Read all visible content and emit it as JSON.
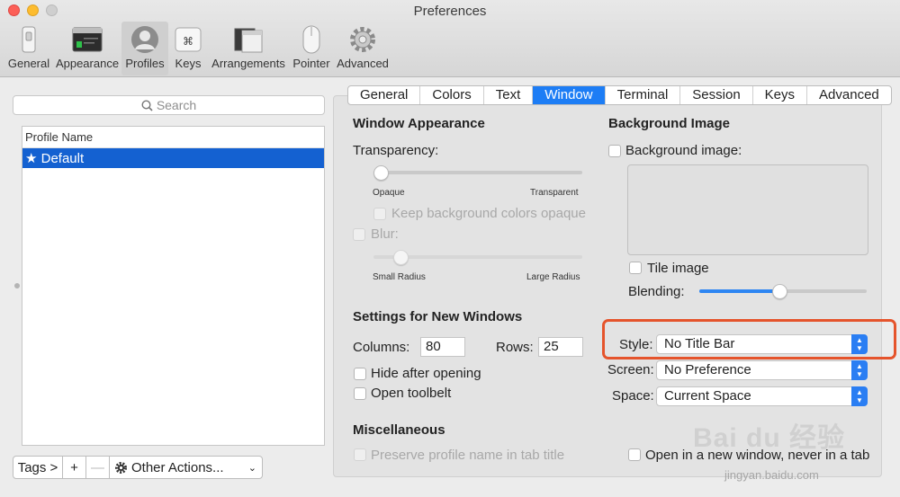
{
  "window": {
    "title": "Preferences"
  },
  "toolbar": {
    "items": [
      {
        "label": "General",
        "icon": "general-switch-icon"
      },
      {
        "label": "Appearance",
        "icon": "appearance-terminal-icon"
      },
      {
        "label": "Profiles",
        "icon": "profiles-person-icon",
        "selected": true
      },
      {
        "label": "Keys",
        "icon": "keys-command-icon"
      },
      {
        "label": "Arrangements",
        "icon": "arrangements-windows-icon"
      },
      {
        "label": "Pointer",
        "icon": "pointer-mouse-icon"
      },
      {
        "label": "Advanced",
        "icon": "advanced-gear-icon"
      }
    ]
  },
  "sidebar": {
    "search_placeholder": "Search",
    "column_header": "Profile Name",
    "profiles": [
      {
        "name": "★ Default",
        "selected": true
      }
    ],
    "buttons": {
      "tags": "Tags >",
      "add": "+",
      "remove": "—",
      "other_actions": "Other Actions..."
    }
  },
  "tabs": [
    {
      "label": "General"
    },
    {
      "label": "Colors"
    },
    {
      "label": "Text"
    },
    {
      "label": "Window",
      "active": true
    },
    {
      "label": "Terminal"
    },
    {
      "label": "Session"
    },
    {
      "label": "Keys"
    },
    {
      "label": "Advanced"
    }
  ],
  "window_appearance": {
    "heading": "Window Appearance",
    "transparency_label": "Transparency:",
    "transparency_value": 0.0,
    "transparency_min": "Opaque",
    "transparency_max": "Transparent",
    "keep_bg_opaque_label": "Keep background colors opaque",
    "blur_label": "Blur:",
    "blur_value": 0.1,
    "blur_min": "Small Radius",
    "blur_max": "Large Radius"
  },
  "background_image": {
    "heading": "Background Image",
    "checkbox_label": "Background image:",
    "tile_label": "Tile image",
    "blending_label": "Blending:",
    "blending_value": 0.48
  },
  "new_windows": {
    "heading": "Settings for New Windows",
    "columns_label": "Columns:",
    "columns_value": "80",
    "rows_label": "Rows:",
    "rows_value": "25",
    "hide_after_opening": "Hide after opening",
    "open_toolbelt": "Open toolbelt"
  },
  "window_style": {
    "style_label": "Style:",
    "style_value": "No Title Bar",
    "screen_label": "Screen:",
    "screen_value": "No Preference",
    "space_label": "Space:",
    "space_value": "Current Space"
  },
  "misc": {
    "heading": "Miscellaneous",
    "preserve_label": "Preserve profile name in tab title",
    "open_new_window_label": "Open in a new window, never in a tab"
  },
  "watermark": {
    "text": "Bai du 经验",
    "sub": "jingyan.baidu.com"
  },
  "colors": {
    "accent": "#1d7df5",
    "selection": "#1461d1",
    "highlight": "#e5542c"
  }
}
